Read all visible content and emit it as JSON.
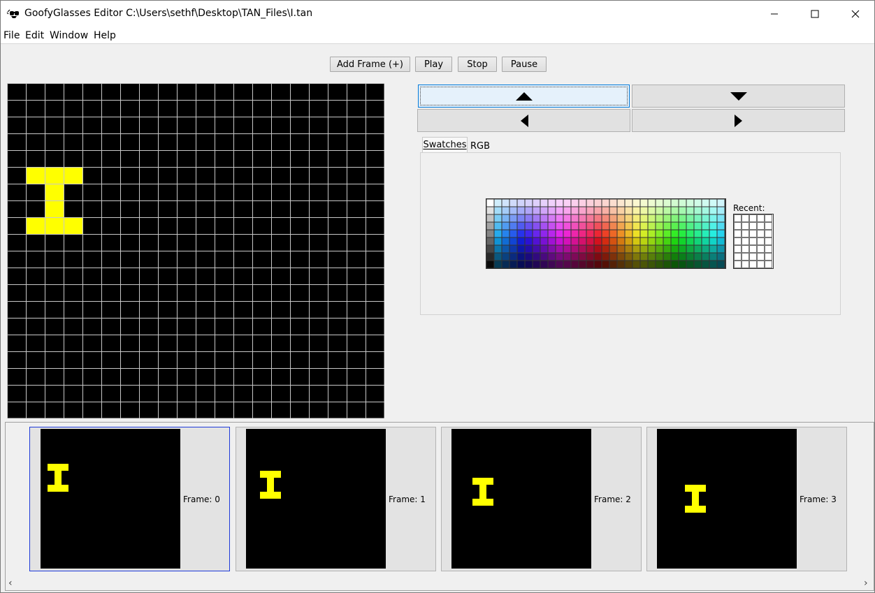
{
  "window": {
    "title": "GoofyGlasses Editor C:\\Users\\sethf\\Desktop\\TAN_Files\\I.tan",
    "app_icon": "glasses-icon"
  },
  "menu": {
    "items": [
      "File",
      "Edit",
      "Window",
      "Help"
    ]
  },
  "toolbar": {
    "add_frame_label": "Add Frame (+)",
    "play_label": "Play",
    "stop_label": "Stop",
    "pause_label": "Pause"
  },
  "grid": {
    "columns": 20,
    "rows": 20,
    "background_color": "#000000",
    "gridline_color": "#c8c8c8",
    "lit_color": "#ffff00",
    "lit_cells": [
      [
        1,
        5
      ],
      [
        2,
        5
      ],
      [
        3,
        5
      ],
      [
        2,
        6
      ],
      [
        2,
        7
      ],
      [
        1,
        8
      ],
      [
        2,
        8
      ],
      [
        3,
        8
      ]
    ]
  },
  "shift_controls": {
    "up_icon": "triangle-up-icon",
    "down_icon": "triangle-down-icon",
    "left_icon": "triangle-left-icon",
    "right_icon": "triangle-right-icon"
  },
  "color_chooser": {
    "tabs": [
      "Swatches",
      "RGB"
    ],
    "active_tab": "Swatches",
    "recent_label": "Recent:"
  },
  "frames": [
    {
      "label": "Frame: 0",
      "selected": true
    },
    {
      "label": "Frame: 1",
      "selected": false
    },
    {
      "label": "Frame: 2",
      "selected": false
    },
    {
      "label": "Frame: 3",
      "selected": false
    }
  ]
}
